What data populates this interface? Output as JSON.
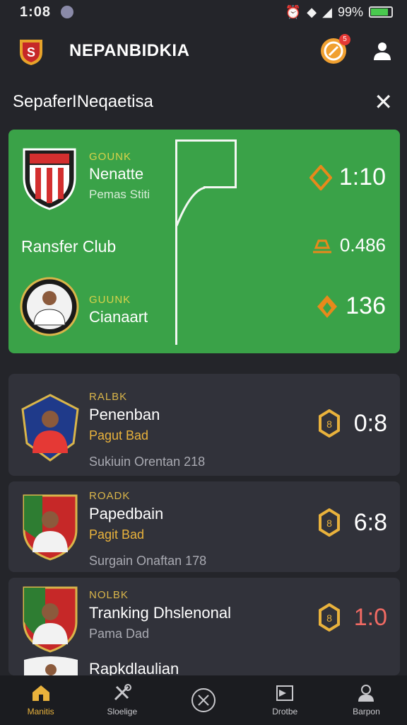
{
  "status": {
    "time": "1:08",
    "battery": "99%"
  },
  "app": {
    "title": "NEPANBIDKIA"
  },
  "section": {
    "title": "SepaferINeqaetisa"
  },
  "hero": {
    "team1": {
      "label": "GOUNK",
      "name": "Nenatte",
      "sub": "Pemas Stiti"
    },
    "club_label": "Ransfer Club",
    "team2": {
      "label": "GUUNK",
      "name": "Cianaart"
    },
    "stats": [
      "1:10",
      "0.486",
      "136"
    ]
  },
  "cards": [
    {
      "label": "RALBK",
      "name": "Penenban",
      "position": "Pagut Bad",
      "location": "Sukiuin Orentan 218",
      "score": "0:8",
      "score_color": "#ffffff"
    },
    {
      "label": "ROADK",
      "name": "Papedbain",
      "position": "Pagit Bad",
      "location": "Surgain Onaftan 178",
      "score": "6:8",
      "score_color": "#ffffff"
    },
    {
      "label": "NOLBK",
      "name": "Tranking Dhslenonal",
      "position": "Pama Dad",
      "location": "",
      "score": "1:0",
      "score_color": "#f06a63"
    },
    {
      "label": "",
      "name": "Rapkdlaulian",
      "position": "",
      "location": "",
      "score": "",
      "score_color": "#ffffff"
    }
  ],
  "nav": [
    {
      "label": "Manitis",
      "icon": "home-icon",
      "active": true
    },
    {
      "label": "Sloelige",
      "icon": "tools-icon",
      "active": false
    },
    {
      "label": "",
      "icon": "close-circle-icon",
      "active": false
    },
    {
      "label": "Drotbe",
      "icon": "flag-icon",
      "active": false
    },
    {
      "label": "Barpon",
      "icon": "profile-icon",
      "active": false
    }
  ],
  "colors": {
    "accent": "#e9b23c",
    "hero_green": "#3aa248",
    "background": "#24252a",
    "card": "#31323a"
  }
}
